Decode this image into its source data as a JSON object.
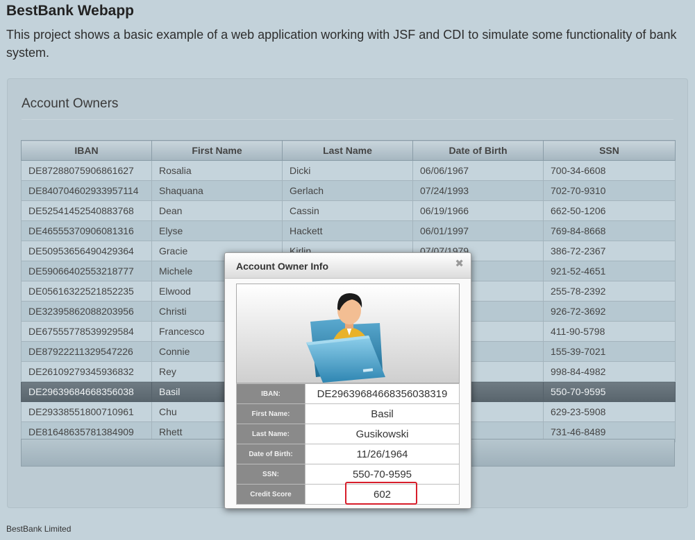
{
  "app": {
    "title": "BestBank Webapp",
    "description": "This project shows a basic example of a web application working with JSF and CDI to simulate some functionality of bank system."
  },
  "panel": {
    "title": "Account Owners"
  },
  "table": {
    "headers": {
      "iban": "IBAN",
      "first_name": "First Name",
      "last_name": "Last Name",
      "dob": "Date of Birth",
      "ssn": "SSN"
    },
    "rows": [
      {
        "iban": "DE87288075906861627",
        "first_name": "Rosalia",
        "last_name": "Dicki",
        "dob": "06/06/1967",
        "ssn": "700-34-6608"
      },
      {
        "iban": "DE840704602933957114",
        "first_name": "Shaquana",
        "last_name": "Gerlach",
        "dob": "07/24/1993",
        "ssn": "702-70-9310"
      },
      {
        "iban": "DE52541452540883768",
        "first_name": "Dean",
        "last_name": "Cassin",
        "dob": "06/19/1966",
        "ssn": "662-50-1206"
      },
      {
        "iban": "DE46555370906081316",
        "first_name": "Elyse",
        "last_name": "Hackett",
        "dob": "06/01/1997",
        "ssn": "769-84-8668"
      },
      {
        "iban": "DE50953656490429364",
        "first_name": "Gracie",
        "last_name": "Kirlin",
        "dob": "07/07/1979",
        "ssn": "386-72-2367"
      },
      {
        "iban": "DE59066402553218777",
        "first_name": "Michele",
        "last_name": "",
        "dob": "",
        "ssn": "921-52-4651"
      },
      {
        "iban": "DE05616322521852235",
        "first_name": "Elwood",
        "last_name": "",
        "dob": "",
        "ssn": "255-78-2392"
      },
      {
        "iban": "DE32395862088203956",
        "first_name": "Christi",
        "last_name": "",
        "dob": "",
        "ssn": "926-72-3692"
      },
      {
        "iban": "DE67555778539929584",
        "first_name": "Francesco",
        "last_name": "",
        "dob": "",
        "ssn": "411-90-5798"
      },
      {
        "iban": "DE87922211329547226",
        "first_name": "Connie",
        "last_name": "",
        "dob": "",
        "ssn": "155-39-7021"
      },
      {
        "iban": "DE26109279345936832",
        "first_name": "Rey",
        "last_name": "",
        "dob": "",
        "ssn": "998-84-4982"
      },
      {
        "iban": "DE29639684668356038",
        "first_name": "Basil",
        "last_name": "",
        "dob": "",
        "ssn": "550-70-9595"
      },
      {
        "iban": "DE29338551800710961",
        "first_name": "Chu",
        "last_name": "",
        "dob": "",
        "ssn": "629-23-5908"
      },
      {
        "iban": "DE81648635781384909",
        "first_name": "Rhett",
        "last_name": "",
        "dob": "",
        "ssn": "731-46-8489"
      }
    ],
    "selected_index": 11
  },
  "dialog": {
    "title": "Account Owner Info",
    "close_icon": "close-icon",
    "owner_image_icon": "user-folder-icon",
    "fields": {
      "iban_label": "IBAN:",
      "iban_value": "DE29639684668356038319",
      "first_name_label": "First Name:",
      "first_name_value": "Basil",
      "last_name_label": "Last Name:",
      "last_name_value": "Gusikowski",
      "dob_label": "Date of Birth:",
      "dob_value": "11/26/1964",
      "ssn_label": "SSN:",
      "ssn_value": "550-70-9595",
      "credit_label": "Credit Score",
      "credit_value": "602"
    },
    "colors": {
      "credit_value": "#2ea02e",
      "credit_highlight": "#d71d2a"
    }
  },
  "footer": {
    "text": "BestBank Limited"
  }
}
